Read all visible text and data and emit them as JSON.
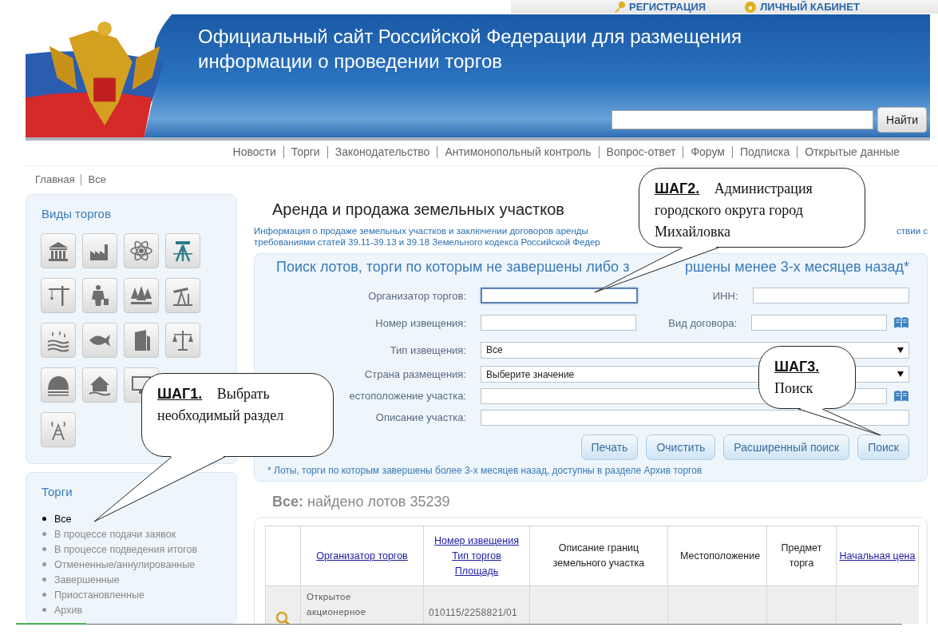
{
  "top_links": [
    {
      "label": "РЕГИСТРАЦИЯ"
    },
    {
      "label": "ЛИЧНЫЙ КАБИНЕТ"
    }
  ],
  "header": {
    "title_lines": [
      "Официальный сайт Российской Федерации для размещения",
      "информации о проведении торгов"
    ],
    "search_button": "Найти"
  },
  "nav": [
    "Новости",
    "Торги",
    "Законодательство",
    "Антимонопольный контроль",
    "Вопрос-ответ",
    "Форум",
    "Подписка",
    "Открытые данные"
  ],
  "breadcrumbs": [
    "Главная",
    "Все"
  ],
  "sidebar": {
    "categories_title": "Виды торгов",
    "categories": [
      {
        "selected": false
      },
      {
        "selected": false
      },
      {
        "selected": false
      },
      {
        "selected": true
      },
      {
        "selected": false
      },
      {
        "selected": false
      },
      {
        "selected": false
      },
      {
        "selected": false
      },
      {
        "selected": false
      },
      {
        "selected": false
      },
      {
        "selected": false
      },
      {
        "selected": false
      },
      {
        "selected": false
      },
      {
        "selected": false
      },
      {
        "selected": false
      },
      {
        "selected": false
      }
    ],
    "trades_title": "Торги",
    "trades": [
      {
        "label": "Все",
        "selected": true
      },
      {
        "label": "В процессе подачи заявок",
        "selected": false
      },
      {
        "label": "В процессе подведения итогов",
        "selected": false
      },
      {
        "label": "Отмененные/аннулированные",
        "selected": false
      },
      {
        "label": "Завершенные",
        "selected": false
      },
      {
        "label": "Приостановленные",
        "selected": false
      },
      {
        "label": "Архив",
        "selected": false
      }
    ]
  },
  "main": {
    "title": "Аренда и продажа земельных участков",
    "info": {
      "line_1_start": "Информация о продаже земельных участков и заключении договоров аренды",
      "line_1_end": "ствии с",
      "line_2": "требованиями статей 39.11-39.13 и 39.18 Земельного кодекса Российской Федер"
    }
  },
  "search": {
    "title_start": "Поиск лотов, торги по которым не завершены либо з",
    "title_end": "ршены менее 3-х месяцев назад*",
    "rows": [
      [
        {
          "label": "Организатор торгов:",
          "kind": "text",
          "focused": true
        },
        {
          "label": "ИНН:",
          "kind": "text",
          "focused": false
        }
      ],
      [
        {
          "label": "Номер извещения:",
          "kind": "text",
          "focused": false
        },
        {
          "label": "Вид договора:",
          "kind": "lookup",
          "focused": false
        }
      ],
      [
        {
          "label": "Тип извещения:",
          "kind": "select",
          "value": "Все"
        }
      ],
      [
        {
          "label": "Страна размещения:",
          "kind": "select",
          "value": "Выберите значение"
        }
      ],
      [
        {
          "label": "естоположение участка:",
          "kind": "lookup",
          "focused": false
        }
      ],
      [
        {
          "label": "Описание участка:",
          "kind": "text",
          "focused": false
        }
      ]
    ],
    "buttons": [
      "Печать",
      "Очистить",
      "Расширенный поиск",
      "Поиск"
    ],
    "footnote": "* Лоты, торги по которым завершены более 3-х месяцев назад, доступны в разделе Архив торгов"
  },
  "results": {
    "heading": "**Все:** найдено лотов 35239",
    "columns": [
      {
        "labels": [
          "Организатор торгов"
        ],
        "link": true
      },
      {
        "labels": [
          "Номер извещения",
          "Тип торгов",
          "Площадь"
        ],
        "link": true
      },
      {
        "labels": [
          "Описание границ земельного участка"
        ],
        "link": false
      },
      {
        "labels": [
          "Местоположение"
        ],
        "link": false
      },
      {
        "labels": [
          "Предмет торга"
        ],
        "link": false
      },
      {
        "labels": [
          "Начальная цена"
        ],
        "link": true
      }
    ],
    "rows": [
      {
        "organizer": "Открытое акционерное",
        "notice": "010115/2258821/01"
      }
    ]
  },
  "callouts": [
    {
      "text": "**ШАГ1.** Выбрать необходимый раздел"
    },
    {
      "text": "**ШАГ2.** Администрация городского округа город Михайловка"
    },
    {
      "text": "**ШАГ3.** Поиск"
    }
  ]
}
